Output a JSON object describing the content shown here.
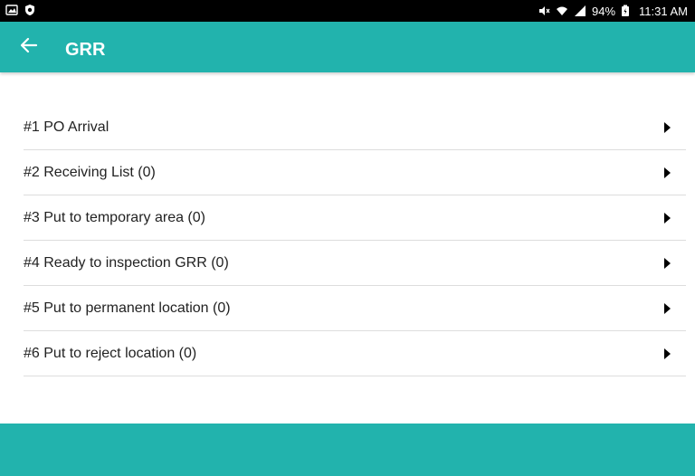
{
  "status_bar": {
    "icons_left": [
      "gallery-icon",
      "shield-icon"
    ],
    "icons_right": [
      "mute-icon",
      "wifi-icon",
      "signal-icon",
      "battery-charging-icon"
    ],
    "battery": "94%",
    "time": "11:31 AM"
  },
  "app_bar": {
    "title": "GRR",
    "back_icon": "arrow-left-icon",
    "color": "#22b3ad"
  },
  "menu": {
    "items": [
      {
        "label": "#1 PO Arrival"
      },
      {
        "label": "#2 Receiving List (0)"
      },
      {
        "label": "#3 Put to temporary area (0)"
      },
      {
        "label": "#4 Ready to inspection GRR (0)"
      },
      {
        "label": "#5 Put to permanent location (0)"
      },
      {
        "label": "#6 Put to reject location (0)"
      }
    ],
    "arrow_icon": "caret-right-icon"
  },
  "theme": {
    "accent": "#22b3ad",
    "divider": "#dddddd",
    "text": "#222222"
  }
}
